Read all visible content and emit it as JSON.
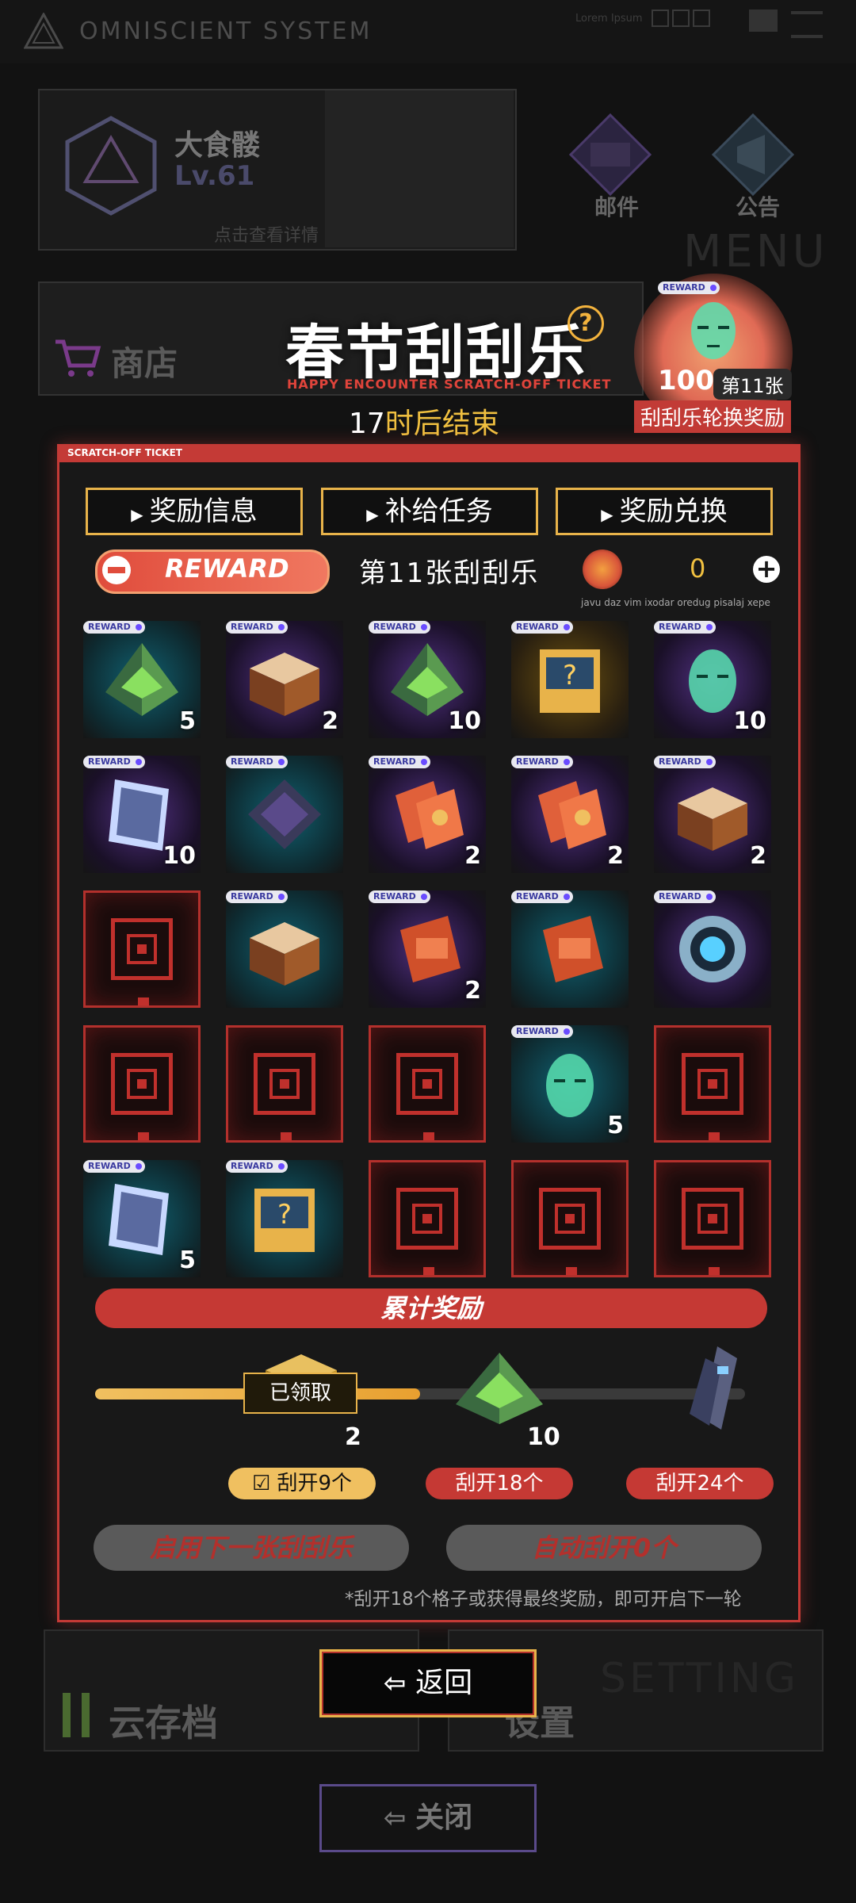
{
  "top_bar": {
    "title": "OMNISCIENT SYSTEM",
    "lorem": "Lorem Ipsum"
  },
  "profile": {
    "name": "大食髅",
    "level": "Lv.61",
    "detail_hint": "点击查看详情"
  },
  "top_buttons": {
    "mail": "邮件",
    "notice": "公告",
    "menu": "MENU"
  },
  "shop": {
    "label": "商店"
  },
  "event": {
    "title": "春节刮刮乐",
    "subtitle": "HAPPY ENCOUNTER SCRATCH-OFF TICKET",
    "countdown_number": "17",
    "countdown_text": "时后结束"
  },
  "rotation_reward": {
    "badge": "REWARD",
    "count": "100",
    "ticket": "第11张",
    "label": "刮刮乐轮换奖励"
  },
  "panel": {
    "header": "SCRATCH-OFF TICKET",
    "tabs": [
      "奖励信息",
      "补给任务",
      "奖励兑换"
    ],
    "reward_pill": "REWARD",
    "ticket_label": "第11张刮刮乐",
    "coin_value": "0",
    "lorem": "javu daz vim ixodar oredug pisalaj xepe"
  },
  "grid": [
    {
      "state": "prize",
      "badge": "REWARD",
      "item": "pyramid",
      "glow": "teal",
      "qty": "5"
    },
    {
      "state": "prize",
      "badge": "REWARD",
      "item": "crate",
      "glow": "purple",
      "qty": "2"
    },
    {
      "state": "prize",
      "badge": "REWARD",
      "item": "pyramid",
      "glow": "purple",
      "qty": "10"
    },
    {
      "state": "prize",
      "badge": "REWARD",
      "item": "mystery-box",
      "glow": "gold",
      "qty": ""
    },
    {
      "state": "prize",
      "badge": "REWARD",
      "item": "holo-head",
      "glow": "purple",
      "qty": "10"
    },
    {
      "state": "prize",
      "badge": "REWARD",
      "item": "data-card",
      "glow": "purple",
      "qty": "10"
    },
    {
      "state": "prize",
      "badge": "REWARD",
      "item": "chip",
      "glow": "teal",
      "qty": ""
    },
    {
      "state": "prize",
      "badge": "REWARD",
      "item": "red-envelope",
      "glow": "purple",
      "qty": "2"
    },
    {
      "state": "prize",
      "badge": "REWARD",
      "item": "red-envelope",
      "glow": "purple",
      "qty": "2"
    },
    {
      "state": "prize",
      "badge": "REWARD",
      "item": "crate",
      "glow": "purple",
      "qty": "2"
    },
    {
      "state": "locked"
    },
    {
      "state": "prize",
      "badge": "REWARD",
      "item": "crate",
      "glow": "teal",
      "qty": ""
    },
    {
      "state": "prize",
      "badge": "REWARD",
      "item": "red-pack",
      "glow": "purple",
      "qty": "2"
    },
    {
      "state": "prize",
      "badge": "REWARD",
      "item": "red-pack",
      "glow": "teal",
      "qty": ""
    },
    {
      "state": "prize",
      "badge": "REWARD",
      "item": "core-ring",
      "glow": "purple",
      "qty": ""
    },
    {
      "state": "locked"
    },
    {
      "state": "locked"
    },
    {
      "state": "locked"
    },
    {
      "state": "prize",
      "badge": "REWARD",
      "item": "holo-head",
      "glow": "teal",
      "qty": "5"
    },
    {
      "state": "locked"
    },
    {
      "state": "prize",
      "badge": "REWARD",
      "item": "data-card",
      "glow": "teal",
      "qty": "5"
    },
    {
      "state": "prize",
      "badge": "REWARD",
      "item": "mystery-box",
      "glow": "teal",
      "qty": ""
    },
    {
      "state": "locked"
    },
    {
      "state": "locked"
    },
    {
      "state": "locked"
    }
  ],
  "cumulative": {
    "title": "累计奖励",
    "progress": 0.5,
    "claimed_label": "已领取",
    "milestone_qty": [
      "2",
      "10"
    ],
    "steps": [
      "刮开9个",
      "刮开18个",
      "刮开24个"
    ],
    "next_ticket": "启用下一张刮刮乐",
    "auto_scratch": "自动刮开0个",
    "note": "*刮开18个格子或获得最终奖励，即可开启下一轮"
  },
  "bottom": {
    "cloud": "云存档",
    "setting": "设置",
    "setting_bg": "SETTING",
    "back": "返回",
    "close": "关闭"
  },
  "colors": {
    "accent_red": "#c53934",
    "accent_gold": "#e8b34a"
  }
}
